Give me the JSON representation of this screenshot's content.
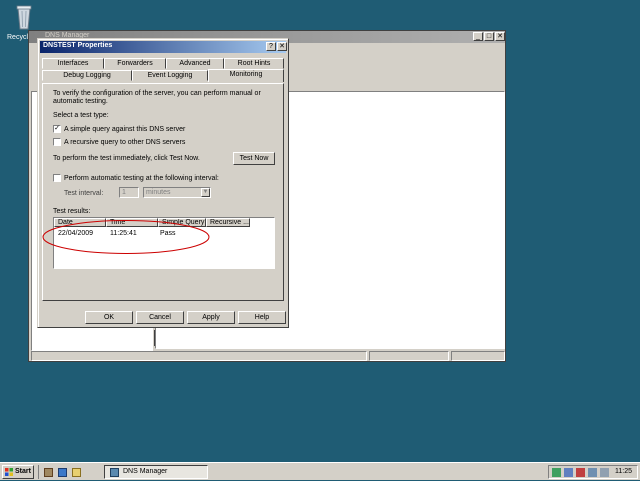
{
  "desktop": {
    "recycle_label": "Recycle Bin"
  },
  "main_window": {
    "title": "DNS Manager"
  },
  "dialog": {
    "title": "DNSTEST Properties",
    "help_btn": "?",
    "close_btn": "✕",
    "tabs_row1": [
      "Interfaces",
      "Forwarders",
      "Advanced",
      "Root Hints"
    ],
    "tabs_row2": [
      "Debug Logging",
      "Event Logging",
      "Monitoring"
    ],
    "active_tab": "Monitoring",
    "intro": [
      "To verify the configuration of the server, you can perform manual or",
      "automatic testing."
    ],
    "select_type_label": "Select a test type:",
    "simple_query": {
      "label": "A simple query against this DNS server",
      "checked": true
    },
    "recursive_query": {
      "label": "A recursive query to other DNS servers",
      "checked": false
    },
    "perform_now_label": "To perform the test immediately, click Test Now.",
    "test_now_btn": "Test Now",
    "auto_testing": {
      "label": "Perform automatic testing at the following interval:",
      "checked": false
    },
    "interval_label": "Test interval:",
    "interval_value": "1",
    "interval_unit": "minutes",
    "results_label": "Test results:",
    "columns": [
      "Date",
      "Time",
      "Simple Query",
      "Recursive ..."
    ],
    "rows": [
      {
        "date": "22/04/2009",
        "time": "11:25:41",
        "simple": "Pass",
        "recursive": ""
      }
    ],
    "buttons": {
      "ok": "OK",
      "cancel": "Cancel",
      "apply": "Apply",
      "help": "Help"
    },
    "annotation_color": "#cc0000"
  },
  "taskbar": {
    "start": "Start",
    "task": "DNS Manager",
    "clock": "11:25"
  },
  "colors": {
    "desktop": "#1f5c74",
    "title_active": "#0a246a",
    "face": "#d4d0c8"
  }
}
